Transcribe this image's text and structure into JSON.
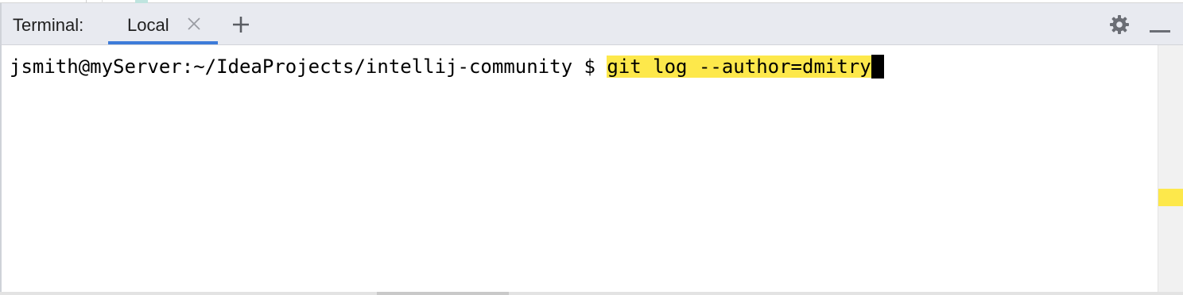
{
  "toolwindow": {
    "title": "Terminal:",
    "tabs": [
      {
        "label": "Local",
        "active": true,
        "closable": true
      }
    ],
    "add_tab_icon": "plus-icon",
    "settings_icon": "gear-icon",
    "hide_icon": "minimize-icon"
  },
  "terminal": {
    "prompt": "jsmith@myServer:~/IdeaProjects/intellij-community $ ",
    "command": "git log --author=dmitry",
    "highlight_color": "#fde84b"
  },
  "colors": {
    "toolbar_bg": "#e8eaf0",
    "active_tab_accent": "#3d7bd9",
    "search_highlight": "#fde84b"
  }
}
